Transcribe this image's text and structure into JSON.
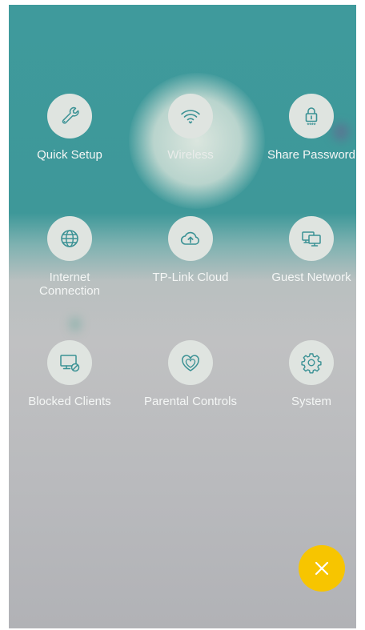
{
  "colors": {
    "icon_stroke": "#3a9194",
    "icon_bg": "#dfe4e0",
    "fab_bg": "#f7c500",
    "fab_icon": "#ffffff",
    "label_text": "#f4f6f5"
  },
  "menu": {
    "items": [
      {
        "label": "Quick Setup",
        "icon": "wrench-icon"
      },
      {
        "label": "Wireless",
        "icon": "wifi-icon"
      },
      {
        "label": "Share Password",
        "icon": "lock-password-icon"
      },
      {
        "label": "Internet\nConnection",
        "icon": "globe-icon"
      },
      {
        "label": "TP-Link Cloud",
        "icon": "cloud-upload-icon"
      },
      {
        "label": "Guest Network",
        "icon": "monitors-icon"
      },
      {
        "label": "Blocked Clients",
        "icon": "blocked-monitor-icon"
      },
      {
        "label": "Parental Controls",
        "icon": "hearts-icon"
      },
      {
        "label": "System",
        "icon": "gear-icon"
      }
    ]
  },
  "fab": {
    "icon": "close-icon"
  }
}
